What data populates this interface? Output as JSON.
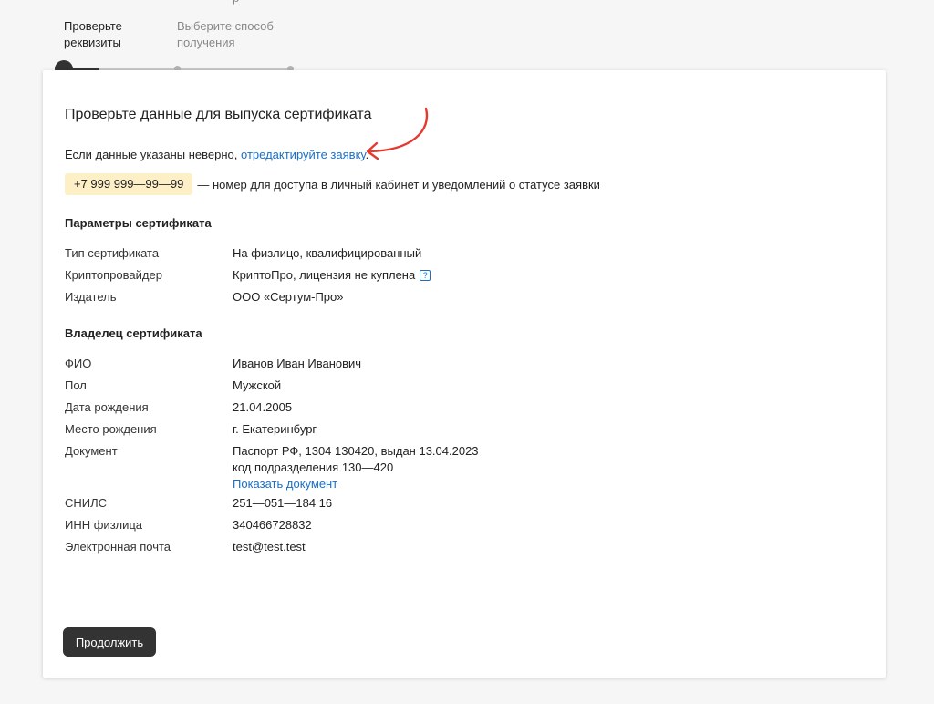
{
  "stepper": {
    "steps": [
      {
        "label": "Проверьте\nреквизиты",
        "state": "active"
      },
      {
        "label": "Выберите способ\nполучения",
        "state": "inactive"
      }
    ],
    "cut_label": "р"
  },
  "page": {
    "title": "Проверьте данные для выпуска сертификата",
    "notice_text": "Если данные указаны неверно, ",
    "notice_link": "отредактируйте заявку",
    "notice_end": ".",
    "phone": "+7 999 999—99—99",
    "phone_desc": "— номер для доступа в личный кабинет и уведомлений о статусе заявки"
  },
  "cert_params": {
    "title": "Параметры сертификата",
    "rows": [
      {
        "label": "Тип сертификата",
        "value": "На физлицо, квалифицированный"
      },
      {
        "label": "Криптопровайдер",
        "value": "КриптоПро, лицензия не куплена"
      },
      {
        "label": "Издатель",
        "value": "ООО «Сертум-Про»"
      }
    ],
    "help_icon": "?"
  },
  "owner": {
    "title": "Владелец сертификата",
    "rows": [
      {
        "label": "ФИО",
        "value": "Иванов Иван Иванович"
      },
      {
        "label": "Пол",
        "value": "Мужской"
      },
      {
        "label": "Дата рождения",
        "value": "21.04.2005"
      },
      {
        "label": "Место рождения",
        "value": "г. Екатеринбург"
      },
      {
        "label": "Документ",
        "value": "Паспорт РФ, 1304 130420, выдан 13.04.2023",
        "value2": "код подразделения 130—420",
        "link": "Показать документ"
      },
      {
        "label": "СНИЛС",
        "value": "251—051—184 16"
      },
      {
        "label": "ИНН физлица",
        "value": "340466728832"
      },
      {
        "label": "Электронная почта",
        "value": "test@test.test"
      }
    ]
  },
  "actions": {
    "continue_label": "Продолжить"
  },
  "colors": {
    "accent_link": "#1a6fc4",
    "phone_badge_bg": "#fdefc6",
    "annotation_arrow": "#e5392e",
    "button_bg": "#333333"
  }
}
